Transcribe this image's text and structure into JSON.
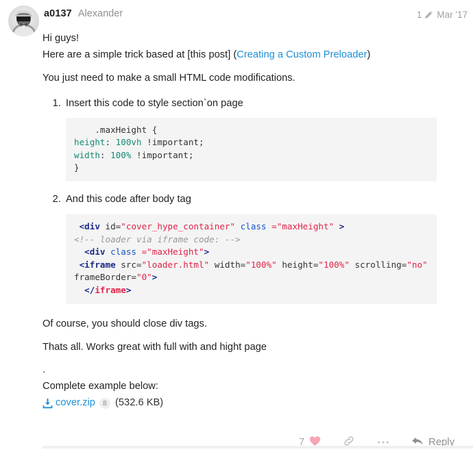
{
  "post": {
    "author": {
      "username": "a0137",
      "fullname": "Alexander",
      "avatar_alt": "user-avatar-photo"
    },
    "meta": {
      "edit_count": "1",
      "edit_icon": "pencil-icon",
      "date": "Mar '17"
    },
    "body": {
      "greeting": "Hi guys!",
      "intro_before_link": "Here are a simple trick based at [this post] (",
      "intro_link": "Creating a Custom Preloader",
      "intro_after_link": ")",
      "note": "You just need to make a small HTML code modifications.",
      "steps": [
        {
          "text": "Insert this code to style section`on page"
        },
        {
          "text": "And this code after body tag"
        }
      ],
      "code_css": {
        "lines": [
          [
            {
              "t": "    .maxHeight {",
              "c": "plain"
            }
          ],
          [
            {
              "t": "height",
              "c": "prop"
            },
            {
              "t": ": ",
              "c": "plain"
            },
            {
              "t": "100vh",
              "c": "val"
            },
            {
              "t": " !important;",
              "c": "plain"
            }
          ],
          [
            {
              "t": "width",
              "c": "prop"
            },
            {
              "t": ": ",
              "c": "plain"
            },
            {
              "t": "100%",
              "c": "val"
            },
            {
              "t": " !important;",
              "c": "plain"
            }
          ],
          [
            {
              "t": "}",
              "c": "plain"
            }
          ]
        ]
      },
      "code_html": {
        "lines": [
          [
            {
              "t": " <div",
              "c": "tag"
            },
            {
              "t": " id=",
              "c": "attr-d"
            },
            {
              "t": "\"cover_hype_container\"",
              "c": "str"
            },
            {
              "t": " class ",
              "c": "attr"
            },
            {
              "t": "=\"maxHeight\"",
              "c": "str"
            },
            {
              "t": " >",
              "c": "tag"
            }
          ],
          [
            {
              "t": "<!-- loader via iframe code: -->",
              "c": "cmt"
            }
          ],
          [
            {
              "t": "  <div",
              "c": "tag"
            },
            {
              "t": " class ",
              "c": "attr"
            },
            {
              "t": "=\"maxHeight\"",
              "c": "str"
            },
            {
              "t": ">",
              "c": "tag"
            }
          ],
          [
            {
              "t": " <iframe",
              "c": "tag"
            },
            {
              "t": " src=",
              "c": "attr-d"
            },
            {
              "t": "\"loader.html\"",
              "c": "str"
            },
            {
              "t": " width=",
              "c": "attr-d"
            },
            {
              "t": "\"100%\"",
              "c": "str"
            },
            {
              "t": " height=",
              "c": "attr-d"
            },
            {
              "t": "\"100%\"",
              "c": "str"
            },
            {
              "t": " scrolling=",
              "c": "attr-d"
            },
            {
              "t": "\"no\"",
              "c": "str"
            },
            {
              "t": " frameBorder=",
              "c": "attr-d"
            },
            {
              "t": "\"0\"",
              "c": "str"
            },
            {
              "t": ">",
              "c": "tag"
            }
          ],
          [
            {
              "t": "  </",
              "c": "tag"
            },
            {
              "t": "iframe",
              "c": "close"
            },
            {
              "t": ">",
              "c": "tag"
            }
          ]
        ]
      },
      "outro1": "Of course, you should close div tags.",
      "outro2": "Thats all. Works great with full with and hight page",
      "outro3": ".",
      "outro4": "Complete example below:"
    },
    "attachment": {
      "icon": "download-icon",
      "filename": "cover.zip",
      "download_count": "8",
      "filesize": "(532.6 KB)"
    },
    "actions": {
      "like_count": "7",
      "like_icon": "heart-icon",
      "like_color": "#f7a5b5",
      "share_icon": "link-icon",
      "more_icon": "ellipsis-icon",
      "reply_icon": "reply-arrow-icon",
      "reply_label": "Reply"
    }
  },
  "theme": {
    "link_color": "#1e90d6",
    "code_bg": "#f4f4f4",
    "tag_color": "#1c2a8a",
    "string_color": "#e0234a",
    "css_prop_color": "#178b75"
  }
}
